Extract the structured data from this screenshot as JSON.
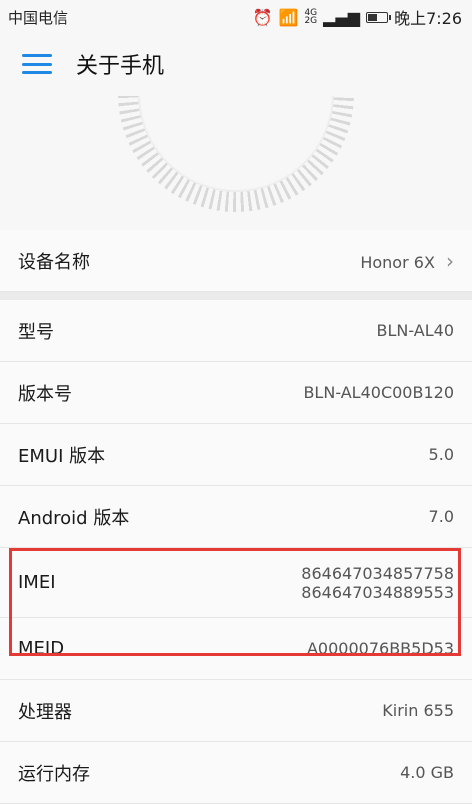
{
  "status": {
    "carrier": "中国电信",
    "network_top": "4G",
    "network_bottom": "2G",
    "time": "晚上7:26",
    "battery_level": 0.45
  },
  "header": {
    "title": "关于手机"
  },
  "device": {
    "label": "设备名称",
    "value": "Honor 6X"
  },
  "items": [
    {
      "label": "型号",
      "value": "BLN-AL40"
    },
    {
      "label": "版本号",
      "value": "BLN-AL40C00B120"
    },
    {
      "label": "EMUI 版本",
      "value": "5.0"
    },
    {
      "label": "Android 版本",
      "value": "7.0"
    },
    {
      "label": "IMEI",
      "value": [
        "864647034857758",
        "864647034889553"
      ]
    },
    {
      "label": "MEID",
      "value": "A0000076BB5D53"
    },
    {
      "label": "处理器",
      "value": "Kirin 655"
    },
    {
      "label": "运行内存",
      "value": "4.0 GB"
    }
  ],
  "colors": {
    "accent": "#1e88e5",
    "highlight": "#e53935"
  }
}
